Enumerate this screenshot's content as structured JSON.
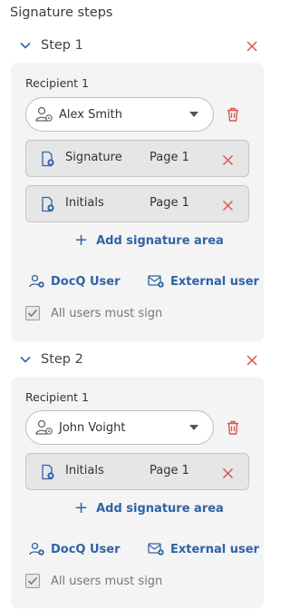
{
  "panel": {
    "title": "Signature steps"
  },
  "steps": [
    {
      "label": "Step 1",
      "recipient_label": "Recipient 1",
      "recipient_name": "Alex Smith",
      "fields": [
        {
          "type": "Signature",
          "page": "Page 1"
        },
        {
          "type": "Initials",
          "page": "Page 1"
        }
      ],
      "add_area_label": "Add signature area",
      "docq_user_label": "DocQ User",
      "external_user_label": "External user",
      "must_sign_label": "All users must sign",
      "must_sign_checked": true
    },
    {
      "label": "Step 2",
      "recipient_label": "Recipient 1",
      "recipient_name": "John Voight",
      "fields": [
        {
          "type": "Initials",
          "page": "Page 1"
        }
      ],
      "add_area_label": "Add signature area",
      "docq_user_label": "DocQ User",
      "external_user_label": "External user",
      "must_sign_label": "All users must sign",
      "must_sign_checked": true
    }
  ],
  "colors": {
    "accent": "#2f63a6",
    "danger": "#d9534f",
    "card": "#f4f4f4"
  }
}
